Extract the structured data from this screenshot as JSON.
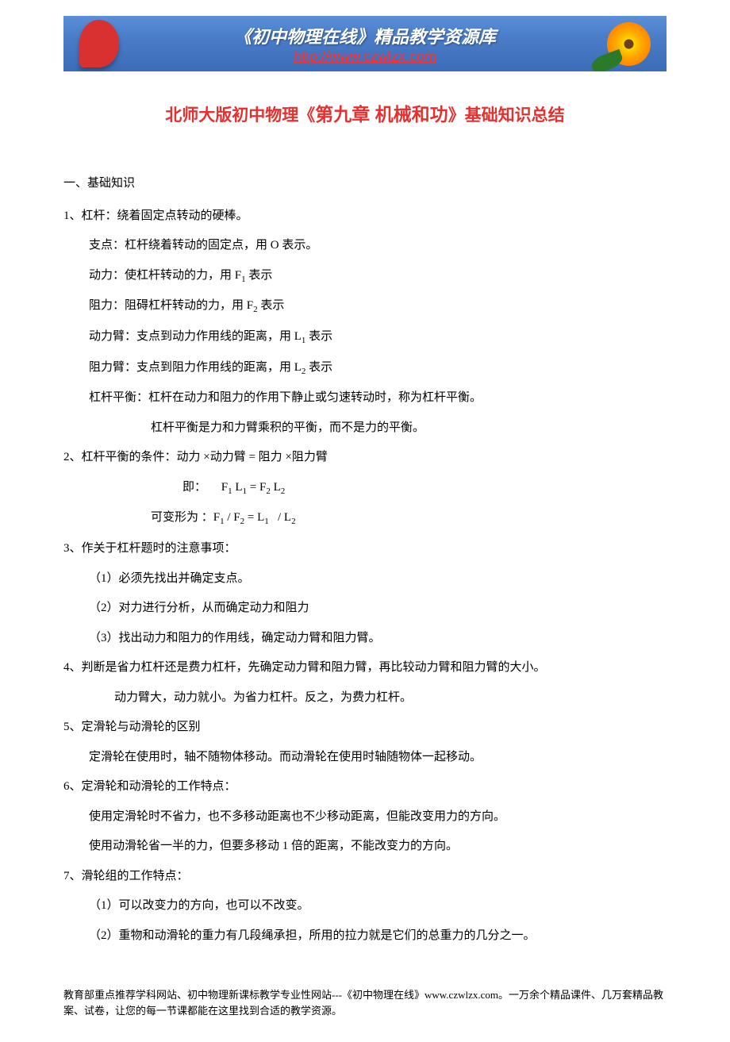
{
  "header": {
    "title": "《初中物理在线》精品教学资源库",
    "url": "http://www.czwlzx.com"
  },
  "title": {
    "prefix": "北师大版初中物理《",
    "chapter": "第九章 机械和功",
    "suffix": "》基础知识总结"
  },
  "content": {
    "section_label": "一、基础知识",
    "items": [
      {
        "type": "p",
        "class": "",
        "text": "1、杠杆：绕着固定点转动的硬棒。"
      },
      {
        "type": "p",
        "class": "indent-1",
        "text": "支点：杠杆绕着转动的固定点，用 O 表示。"
      },
      {
        "type": "sub",
        "class": "indent-1",
        "prefix": "动力：使杠杆转动的力，用 F",
        "sub": "1",
        "suffix": " 表示"
      },
      {
        "type": "sub",
        "class": "indent-1",
        "prefix": "阻力：阻碍杠杆转动的力，用 F",
        "sub": "2",
        "suffix": " 表示"
      },
      {
        "type": "sub",
        "class": "indent-1",
        "prefix": "动力臂：支点到动力作用线的距离，用 L",
        "sub": "1",
        "suffix": " 表示"
      },
      {
        "type": "sub",
        "class": "indent-1",
        "prefix": "阻力臂：支点到阻力作用线的距离，用 L",
        "sub": "2",
        "suffix": " 表示"
      },
      {
        "type": "p",
        "class": "indent-1",
        "text": "杠杆平衡：杠杆在动力和阻力的作用下静止或匀速转动时，称为杠杆平衡。"
      },
      {
        "type": "p",
        "class": "indent-3",
        "text": "杠杆平衡是力和力臂乘积的平衡，而不是力的平衡。"
      },
      {
        "type": "p",
        "class": "",
        "text": "2、杠杆平衡的条件：动力 ×动力臂 = 阻力 ×阻力臂"
      },
      {
        "type": "formula1",
        "class": "indent-4",
        "label": "即：",
        "f1": "F",
        "s1": "1",
        "l1": " L",
        "ls1": "1",
        "eq": " = F",
        "s2": "2",
        "l2": " L",
        "ls2": "2"
      },
      {
        "type": "formula2",
        "class": "indent-3",
        "label": "可变形为 ：",
        "f1": "F",
        "s1": "1",
        "div1": " / F",
        "s2": "2",
        "eq": " = L",
        "ls1": "1",
        "div2": "   / L",
        "ls2": "2"
      },
      {
        "type": "p",
        "class": "",
        "text": "3、作关于杠杆题时的注意事项："
      },
      {
        "type": "p",
        "class": "indent-1",
        "text": "（1）必须先找出并确定支点。"
      },
      {
        "type": "p",
        "class": "indent-1",
        "text": "（2）对力进行分析，从而确定动力和阻力"
      },
      {
        "type": "p",
        "class": "indent-1",
        "text": "（3）找出动力和阻力的作用线，确定动力臂和阻力臂。"
      },
      {
        "type": "p",
        "class": "",
        "text": "4、判断是省力杠杆还是费力杠杆，先确定动力臂和阻力臂，再比较动力臂和阻力臂的大小。"
      },
      {
        "type": "p",
        "class": "indent-2",
        "text": "动力臂大，动力就小。为省力杠杆。反之，为费力杠杆。"
      },
      {
        "type": "p",
        "class": "",
        "text": "5、定滑轮与动滑轮的区别"
      },
      {
        "type": "p",
        "class": "indent-1",
        "text": "定滑轮在使用时，轴不随物体移动。而动滑轮在使用时轴随物体一起移动。"
      },
      {
        "type": "p",
        "class": "",
        "text": "6、定滑轮和动滑轮的工作特点："
      },
      {
        "type": "p",
        "class": "indent-1",
        "text": "使用定滑轮时不省力，也不多移动距离也不少移动距离，但能改变用力的方向。"
      },
      {
        "type": "p",
        "class": "indent-1",
        "text": "使用动滑轮省一半的力，但要多移动 1 倍的距离，不能改变力的方向。"
      },
      {
        "type": "p",
        "class": "",
        "text": "7、滑轮组的工作特点："
      },
      {
        "type": "p",
        "class": "indent-1",
        "text": "（1）可以改变力的方向，也可以不改变。"
      },
      {
        "type": "p",
        "class": "indent-1",
        "text": "（2）重物和动滑轮的重力有几段绳承担，所用的拉力就是它们的总重力的几分之一。"
      }
    ]
  },
  "footer": {
    "text": "教育部重点推荐学科网站、初中物理新课标教学专业性网站---《初中物理在线》www.czwlzx.com。一万余个精品课件、几万套精品教案、试卷，让您的每一节课都能在这里找到合适的教学资源。"
  }
}
